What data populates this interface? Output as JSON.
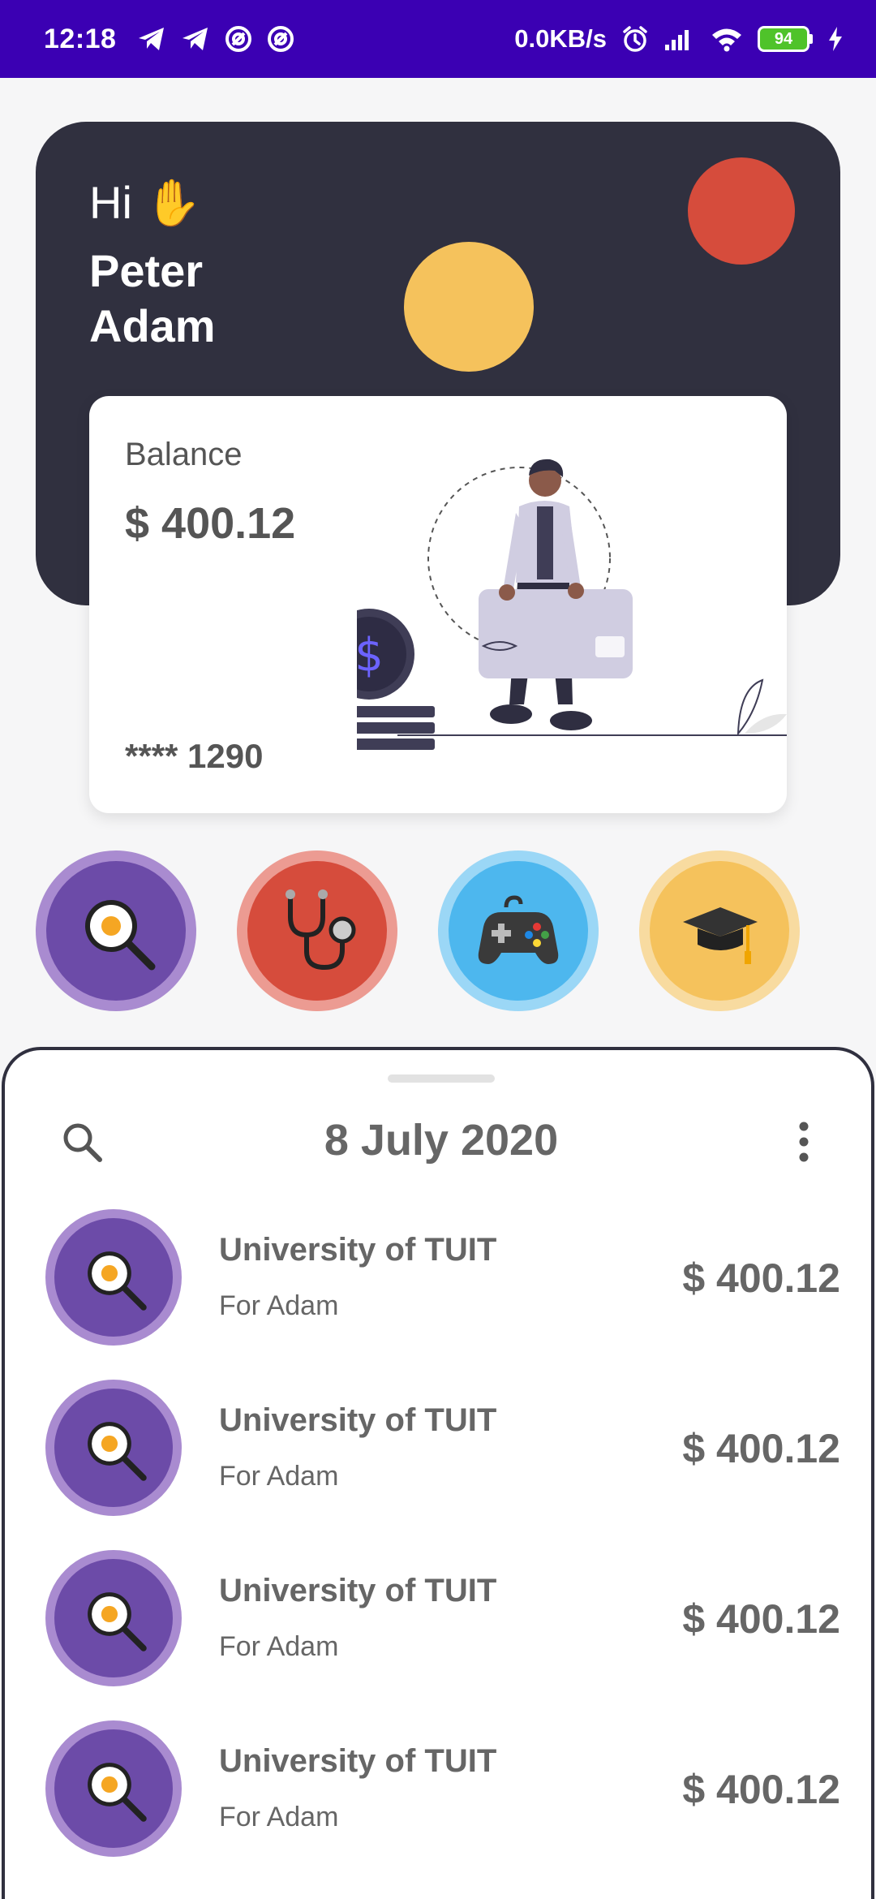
{
  "status_bar": {
    "time": "12:18",
    "network_speed": "0.0KB/s",
    "battery_level": "94",
    "left_icons": [
      "telegram-icon",
      "telegram-icon",
      "vpn-icon",
      "vpn-icon"
    ],
    "right_icons": [
      "alarm-icon",
      "signal-icon",
      "wifi-icon",
      "battery-icon",
      "charging-icon"
    ]
  },
  "header": {
    "greeting": "Hi ✋",
    "user_name": "Peter Adam"
  },
  "balance_card": {
    "label": "Balance",
    "amount": "$ 400.12",
    "card_number": "**** 1290"
  },
  "categories": [
    {
      "icon": "frying-pan-egg-icon",
      "glyph": "🍳",
      "color": "#6c4ba8"
    },
    {
      "icon": "stethoscope-icon",
      "glyph": "🩺",
      "color": "#d64c3c"
    },
    {
      "icon": "game-controller-icon",
      "glyph": "🎮",
      "color": "#4db7ee"
    },
    {
      "icon": "graduation-cap-icon",
      "glyph": "🎓",
      "color": "#f5c25c"
    }
  ],
  "transactions_sheet": {
    "date": "8 July 2020",
    "items": [
      {
        "title": "University of TUIT",
        "subtitle": "For Adam",
        "amount": "$ 400.12",
        "glyph": "🍳"
      },
      {
        "title": "University of TUIT",
        "subtitle": "For Adam",
        "amount": "$ 400.12",
        "glyph": "🍳"
      },
      {
        "title": "University of TUIT",
        "subtitle": "For Adam",
        "amount": "$ 400.12",
        "glyph": "🍳"
      },
      {
        "title": "University of TUIT",
        "subtitle": "For Adam",
        "amount": "$ 400.12",
        "glyph": "🍳"
      }
    ]
  },
  "colors": {
    "status_bar": "#3b00b3",
    "header_bg": "#30303f",
    "accent_yellow": "#f5c25c",
    "accent_red": "#d64c3c",
    "accent_purple": "#6c4ba8",
    "accent_blue": "#4db7ee"
  }
}
